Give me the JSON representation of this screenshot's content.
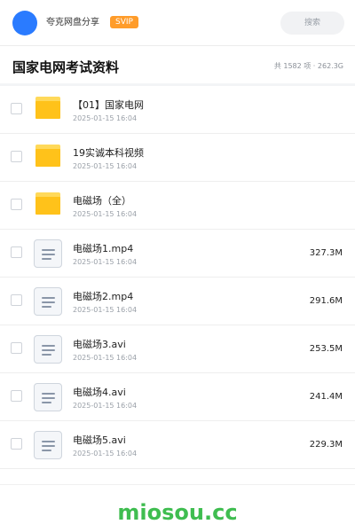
{
  "header": {
    "username": "夸克网盘分享",
    "badge": "SVIP",
    "search_label": "搜索"
  },
  "folder": {
    "title": "国家电网考试资料",
    "stats": "共 1582 项 · 262.3G"
  },
  "items": [
    {
      "type": "folder",
      "icon": "folder-icon",
      "name": "【01】国家电网",
      "date": "2025-01-15 16:04",
      "size": ""
    },
    {
      "type": "folder",
      "icon": "folder-icon",
      "name": "19实诚本科视频",
      "date": "2025-01-15 16:04",
      "size": ""
    },
    {
      "type": "folder",
      "icon": "folder-icon",
      "name": "电磁场（全）",
      "date": "2025-01-15 16:04",
      "size": ""
    },
    {
      "type": "file",
      "icon": "document-icon",
      "name": "电磁场1.mp4",
      "date": "2025-01-15 16:04",
      "size": "327.3M"
    },
    {
      "type": "file",
      "icon": "document-icon",
      "name": "电磁场2.mp4",
      "date": "2025-01-15 16:04",
      "size": "291.6M"
    },
    {
      "type": "file",
      "icon": "document-icon",
      "name": "电磁场3.avi",
      "date": "2025-01-15 16:04",
      "size": "253.5M"
    },
    {
      "type": "file",
      "icon": "document-icon",
      "name": "电磁场4.avi",
      "date": "2025-01-15 16:04",
      "size": "241.4M"
    },
    {
      "type": "file",
      "icon": "document-icon",
      "name": "电磁场5.avi",
      "date": "2025-01-15 16:04",
      "size": "229.3M"
    }
  ],
  "watermark": "miosou.cc",
  "colors": {
    "avatar": "#2a7bff",
    "badge": "#ff9c2a",
    "folder": "#ffc21a",
    "watermark": "#3fbd50"
  }
}
